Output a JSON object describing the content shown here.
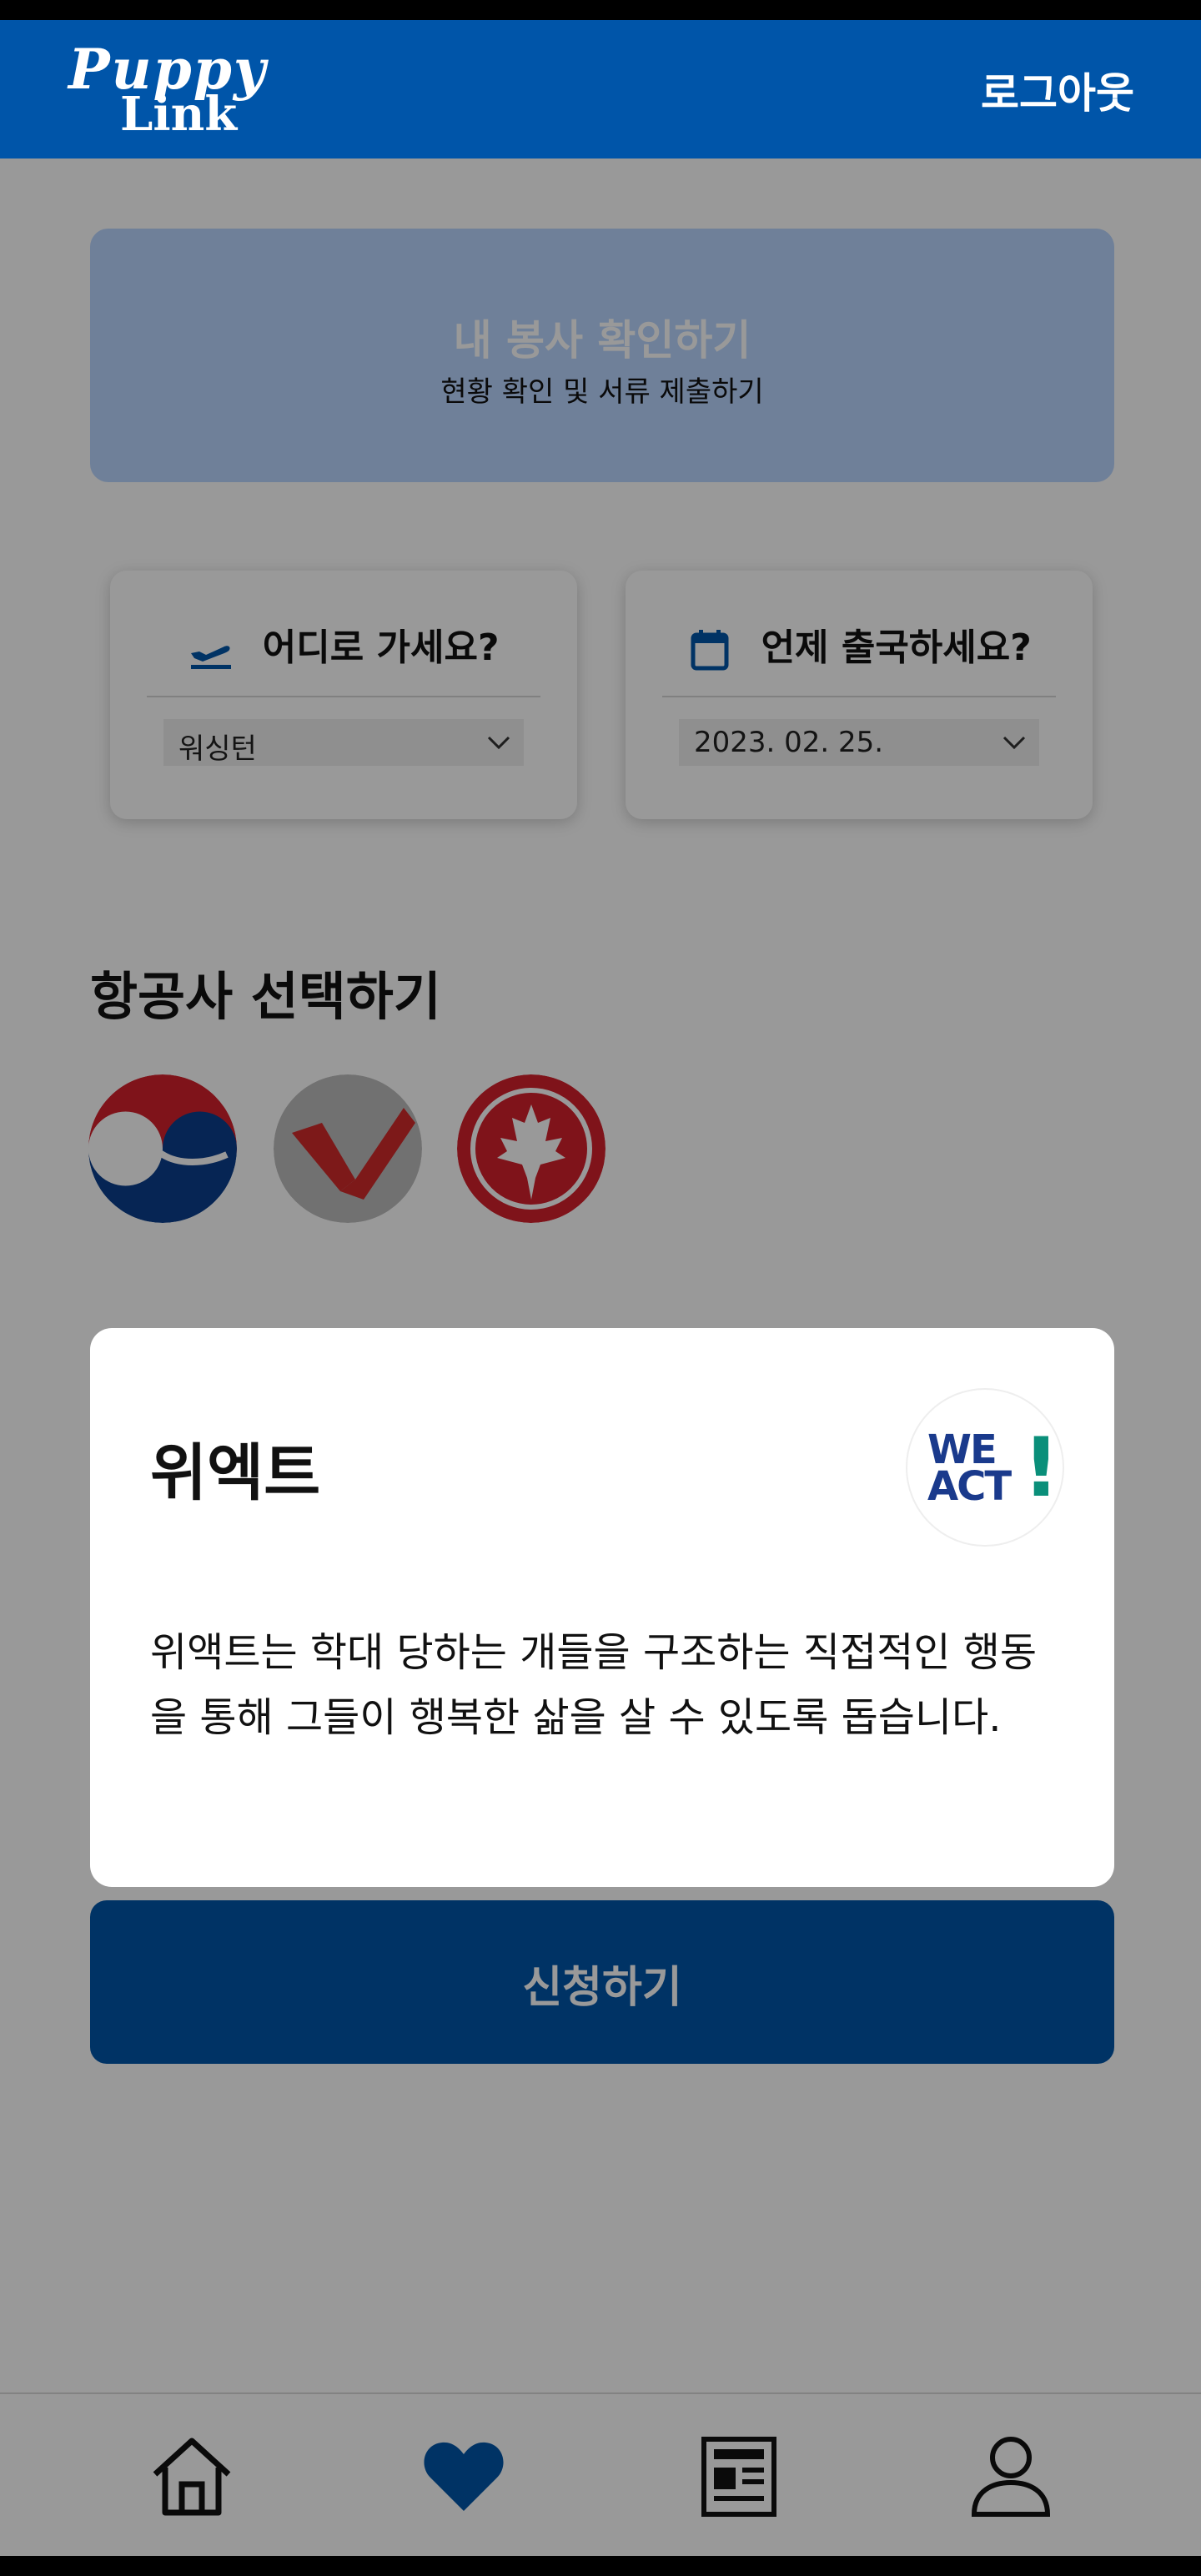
{
  "header": {
    "logo_line1": "Puppy",
    "logo_line2": "Link",
    "logout_label": "로그아웃"
  },
  "my_volunteer": {
    "title": "내 봉사 확인하기",
    "subtitle": "현황 확인 및 서류 제출하기"
  },
  "destination": {
    "title": "어디로 가세요?",
    "icon": "airplane-departure-icon",
    "selected": "워싱턴"
  },
  "departure_date": {
    "title": "언제 출국하세요?",
    "icon": "calendar-icon",
    "selected": "2023. 02. 25."
  },
  "airlines": {
    "title": "항공사 선택하기",
    "items": [
      "korean-air-logo",
      "v-airline-logo",
      "air-canada-logo"
    ]
  },
  "modal": {
    "name": "위엑트",
    "logo_text_1": "WE",
    "logo_text_2": "ACT",
    "logo_text_3": "!",
    "description": "위액트는 학대 당하는 개들을 구조하는 직접적인 행동을 통해 그들이 행복한 삶을 살 수 있도록 돕습니다."
  },
  "apply_button": {
    "label": "신청하기"
  },
  "bottom_nav": {
    "items": [
      "home-icon",
      "heart-icon",
      "news-icon",
      "user-icon"
    ]
  },
  "colors": {
    "primary": "#0055a9",
    "card_light": "#b9d5ff"
  }
}
